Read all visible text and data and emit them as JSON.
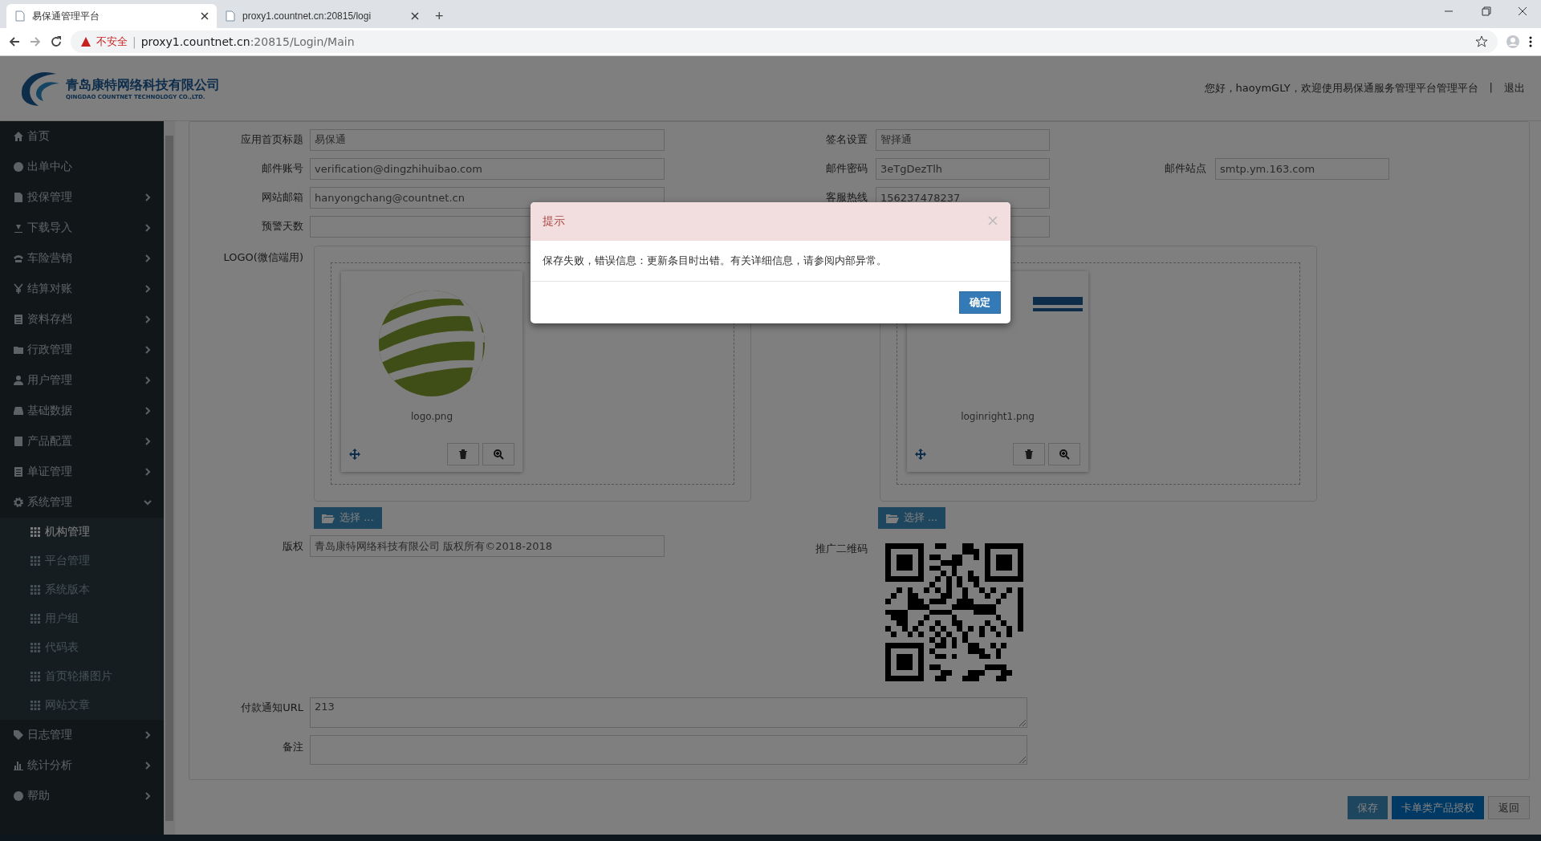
{
  "browser": {
    "tabs": [
      {
        "title": "易保通管理平台",
        "selected": true
      },
      {
        "title": "proxy1.countnet.cn:20815/logi",
        "selected": false
      }
    ],
    "new_tab": "+",
    "security": "不安全",
    "address_separator": "|",
    "url_host": "proxy1.countnet.cn",
    "url_path": ":20815/Login/Main"
  },
  "header": {
    "company": "青岛康特网络科技有限公司",
    "company_en": "QINGDAO COUNTNET TECHNOLOGY CO.,LTD.",
    "greeting": "您好，haoymGLY，欢迎使用易保通服务管理平台管理平台",
    "separator": "|",
    "logout": "退出"
  },
  "sidebar": {
    "items": [
      {
        "label": "首页"
      },
      {
        "label": "出单中心"
      },
      {
        "label": "投保管理",
        "expanded": false
      },
      {
        "label": "下载导入",
        "expanded": false
      },
      {
        "label": "车险营销",
        "expanded": false
      },
      {
        "label": "结算对账",
        "expanded": false
      },
      {
        "label": "资料存档",
        "expanded": false
      },
      {
        "label": "行政管理",
        "expanded": false
      },
      {
        "label": "用户管理",
        "expanded": false
      },
      {
        "label": "基础数据",
        "expanded": false
      },
      {
        "label": "产品配置",
        "expanded": false
      },
      {
        "label": "单证管理",
        "expanded": false
      },
      {
        "label": "系统管理",
        "expanded": true,
        "children": [
          {
            "label": "机构管理",
            "selected": true
          },
          {
            "label": "平台管理",
            "selected": false
          },
          {
            "label": "系统版本",
            "selected": false
          },
          {
            "label": "用户组",
            "selected": false
          },
          {
            "label": "代码表",
            "selected": false
          },
          {
            "label": "首页轮播图片",
            "selected": false
          },
          {
            "label": "网站文章",
            "selected": false
          }
        ]
      },
      {
        "label": "日志管理",
        "expanded": false
      },
      {
        "label": "统计分析",
        "expanded": false
      },
      {
        "label": "帮助",
        "expanded": false
      }
    ]
  },
  "form": {
    "rows": [
      [
        {
          "label": "应用首页标题",
          "value": "易保通"
        },
        {
          "label": "签名设置",
          "value": "智择通"
        }
      ],
      [
        {
          "label": "邮件账号",
          "value": "verification@dingzhihuibao.com"
        },
        {
          "label": "邮件密码",
          "value": "3eTgDezTlh"
        },
        {
          "label": "邮件站点",
          "value": "smtp.ym.163.com"
        }
      ],
      [
        {
          "label": "网站邮箱",
          "value": "hanyongchang@countnet.cn"
        },
        {
          "label": "客服热线",
          "value": "156237478237"
        }
      ],
      [
        {
          "label": "预警天数"
        },
        {}
      ]
    ],
    "logo_label": "LOGO(微信端用)",
    "uploads": [
      {
        "file": "logo.png",
        "select": "选择 ..."
      },
      {
        "file": "loginright1.png",
        "select": "选择 ..."
      }
    ],
    "copyright_label": "版权",
    "copyright": "青岛康特网络科技有限公司 版权所有©2018-2018",
    "qr_label": "推广二维码",
    "pay_url_label": "付款通知URL",
    "pay_url": "213",
    "remark_label": "备注"
  },
  "buttons": [
    "保存",
    "卡单类产品授权",
    "返回"
  ],
  "dialog": {
    "title": "提示",
    "message": "保存失败，错误信息：更新条目时出错。有关详细信息，请参阅内部异常。",
    "ok": "确定"
  }
}
